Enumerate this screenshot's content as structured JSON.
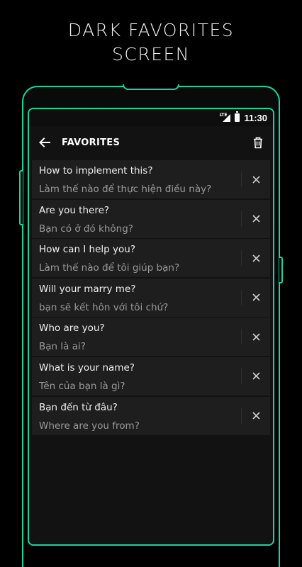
{
  "promo": {
    "line1": "DARK FAVORITES",
    "line2": "SCREEN"
  },
  "status_bar": {
    "network": "LTE",
    "time": "11:30"
  },
  "app_bar": {
    "title": "FAVORITES"
  },
  "favorites": [
    {
      "source": "How to implement this?",
      "translation": "Làm thế nào để thực hiện điều này?"
    },
    {
      "source": "Are you there?",
      "translation": "Bạn có ở đó không?"
    },
    {
      "source": "How can I help you?",
      "translation": "Làm thế nào để tôi giúp bạn?"
    },
    {
      "source": "Will your marry me?",
      "translation": "bạn sẽ kết hôn với tôi chứ?"
    },
    {
      "source": "Who are you?",
      "translation": "Bạn là ai?"
    },
    {
      "source": "What is your name?",
      "translation": "Tên của bạn là gì?"
    },
    {
      "source": "Bạn đến từ đâu?",
      "translation": "Where are you from?"
    }
  ],
  "colors": {
    "accent": "#1bd3a0",
    "background": "#121212",
    "item_background": "#1e1e1e",
    "primary_text": "#f0f0f0",
    "secondary_text": "#9a9a9a"
  },
  "icons": {
    "back": "arrow-left-icon",
    "delete_all": "trash-icon",
    "remove_item": "close-icon"
  }
}
